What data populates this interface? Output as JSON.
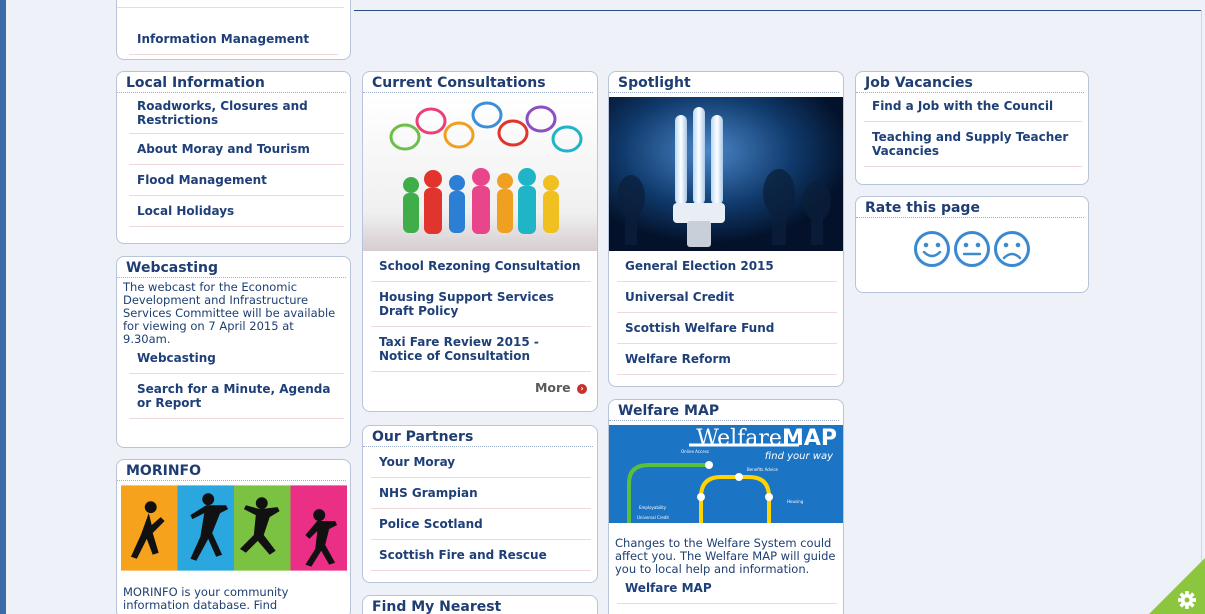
{
  "info_box": {
    "links": [
      "Information Management"
    ]
  },
  "local_info": {
    "title": "Local Information",
    "links": [
      "Roadworks, Closures and Restrictions",
      "About Moray and Tourism",
      "Flood Management",
      "Local Holidays"
    ]
  },
  "webcasting": {
    "title": "Webcasting",
    "text": "The webcast for the Economic Development and Infrastructure Services Committee will be available for viewing on 7 April 2015 at 9.30am.",
    "links": [
      "Webcasting",
      "Search for a Minute, Agenda or Report"
    ]
  },
  "morinfo": {
    "title": "MORINFO",
    "text": "MORINFO is your community information database. Find"
  },
  "consultations": {
    "title": "Current Consultations",
    "links": [
      "School Rezoning Consultation",
      "Housing Support Services Draft Policy",
      "Taxi Fare Review 2015 - Notice of Consultation"
    ],
    "more": "More"
  },
  "partners": {
    "title": "Our Partners",
    "links": [
      "Your Moray",
      "NHS Grampian",
      "Police Scotland",
      "Scottish Fire and Rescue"
    ]
  },
  "nearest": {
    "title": "Find My Nearest"
  },
  "spotlight": {
    "title": "Spotlight",
    "links": [
      "General Election 2015",
      "Universal Credit",
      "Scottish Welfare Fund",
      "Welfare Reform"
    ]
  },
  "welfare_map": {
    "title": "Welfare MAP",
    "image_title": "Welfare",
    "image_title_bold": "MAP",
    "image_tagline": "find your way",
    "station_labels": [
      "Online Access",
      "Benefits Advice",
      "Employability",
      "Housing",
      "Universal Credit"
    ],
    "text": "Changes to the Welfare System could affect you. The Welfare MAP will guide you to local help and information.",
    "link": "Welfare MAP"
  },
  "jobs": {
    "title": "Job Vacancies",
    "links": [
      "Find a Job with the Council",
      "Teaching and Supply Teacher Vacancies"
    ]
  },
  "rate": {
    "title": "Rate this page"
  }
}
